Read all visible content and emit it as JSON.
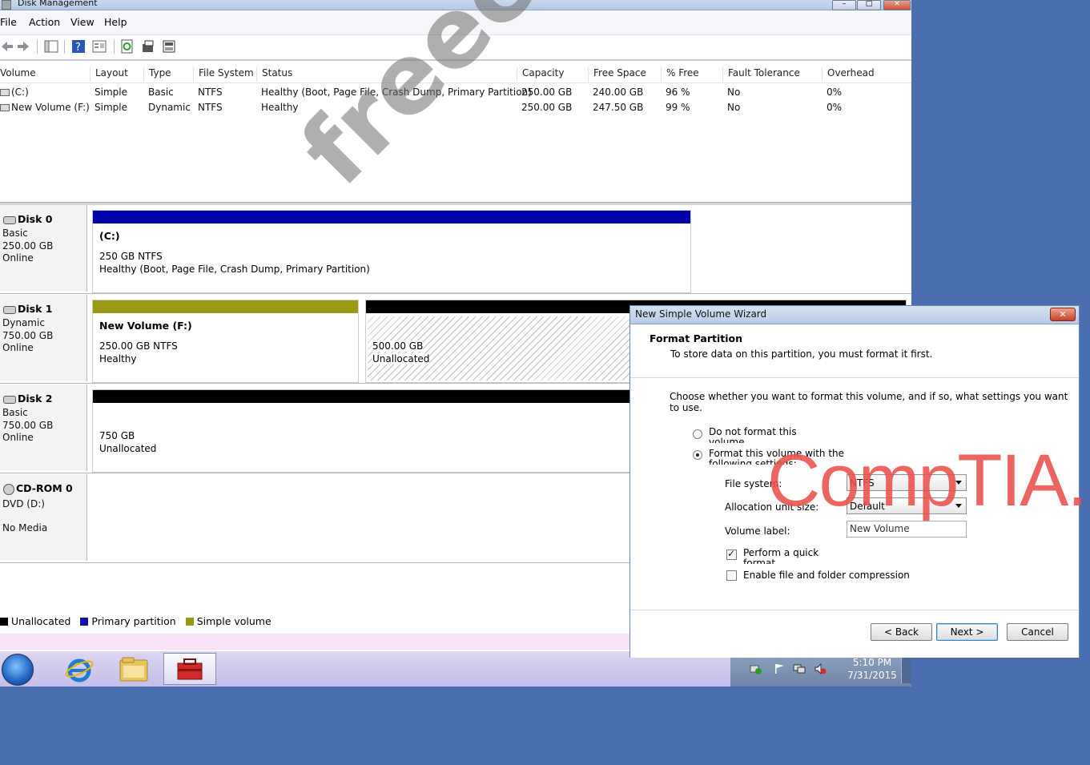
{
  "window": {
    "title": "Disk Management"
  },
  "menu": [
    "File",
    "Action",
    "View",
    "Help"
  ],
  "toolbar": {
    "icons": [
      "back-arrow-icon",
      "forward-arrow-icon",
      "show-hide-tree-icon",
      "help-icon",
      "properties-icon",
      "refresh-icon",
      "export-icon",
      "rescan-disks-icon"
    ]
  },
  "volume_list": {
    "columns": [
      "Volume",
      "Layout",
      "Type",
      "File System",
      "Status",
      "Capacity",
      "Free Space",
      "% Free",
      "Fault Tolerance",
      "Overhead"
    ],
    "rows": [
      [
        "(C:)",
        "Simple",
        "Basic",
        "NTFS",
        "Healthy (Boot, Page File, Crash Dump, Primary Partition)",
        "250.00 GB",
        "240.00 GB",
        "96 %",
        "No",
        "0%"
      ],
      [
        "New Volume (F:)",
        "Simple",
        "Dynamic",
        "NTFS",
        "Healthy",
        "250.00 GB",
        "247.50 GB",
        "99 %",
        "No",
        "0%"
      ]
    ]
  },
  "disks": {
    "disk0": {
      "name": "Disk 0",
      "type": "Basic",
      "size": "250.00 GB",
      "status": "Online",
      "partitions": [
        {
          "title": "(C:)",
          "line1": "250 GB NTFS",
          "line2": "Healthy (Boot, Page File, Crash Dump, Primary Partition)",
          "color": "#0000a8"
        }
      ]
    },
    "disk1": {
      "name": "Disk 1",
      "type": "Dynamic",
      "size": "750.00 GB",
      "status": "Online",
      "partitions": [
        {
          "title": "New Volume (F:)",
          "line1": "250.00 GB NTFS",
          "line2": "Healthy",
          "color": "#9a9a12"
        },
        {
          "title": "",
          "line1": "500.00 GB",
          "line2": "Unallocated",
          "color": "#000000"
        }
      ]
    },
    "disk2": {
      "name": "Disk 2",
      "type": "Basic",
      "size": "750.00 GB",
      "status": "Online",
      "partitions": [
        {
          "title": "",
          "line1": "750 GB",
          "line2": "Unallocated",
          "color": "#000000"
        }
      ]
    },
    "cdrom0": {
      "name": "CD-ROM 0",
      "type": "DVD (D:)",
      "status": "No Media"
    }
  },
  "legend": [
    {
      "label": "Unallocated",
      "color": "#000000"
    },
    {
      "label": "Primary partition",
      "color": "#1414a0"
    },
    {
      "label": "Simple volume",
      "color": "#9a9a12"
    }
  ],
  "taskbar": {
    "apps": [
      "internet-explorer-icon",
      "file-explorer-icon",
      "server-manager-toolbox-icon"
    ],
    "tray_icons": [
      "action-center-icon",
      "flag-icon",
      "network-icon",
      "volume-muted-icon"
    ],
    "time": "5:10 PM",
    "date": "7/31/2015"
  },
  "wizard": {
    "title": "New Simple Volume Wizard",
    "close": "✕",
    "heading": "Format Partition",
    "subheading": "To store data on this partition, you must format it first.",
    "intro": "Choose whether you want to format this volume, and if so, what settings you want to use.",
    "option_no_format": "Do not format this volume",
    "option_format": "Format this volume with the following settings:",
    "file_system_label": "File system:",
    "file_system_value": "NTFS",
    "alloc_label": "Allocation unit size:",
    "alloc_value": "Default",
    "volume_label_label": "Volume label:",
    "volume_label_value": "New Volume",
    "quick_format_label": "Perform a quick format",
    "quick_format_checked": true,
    "compression_label": "Enable file and folder compression",
    "compression_checked": false,
    "back": "< Back",
    "next": "Next >",
    "cancel": "Cancel"
  },
  "overlays": {
    "watermark": "freecram.net",
    "brand": "CompTIA."
  }
}
